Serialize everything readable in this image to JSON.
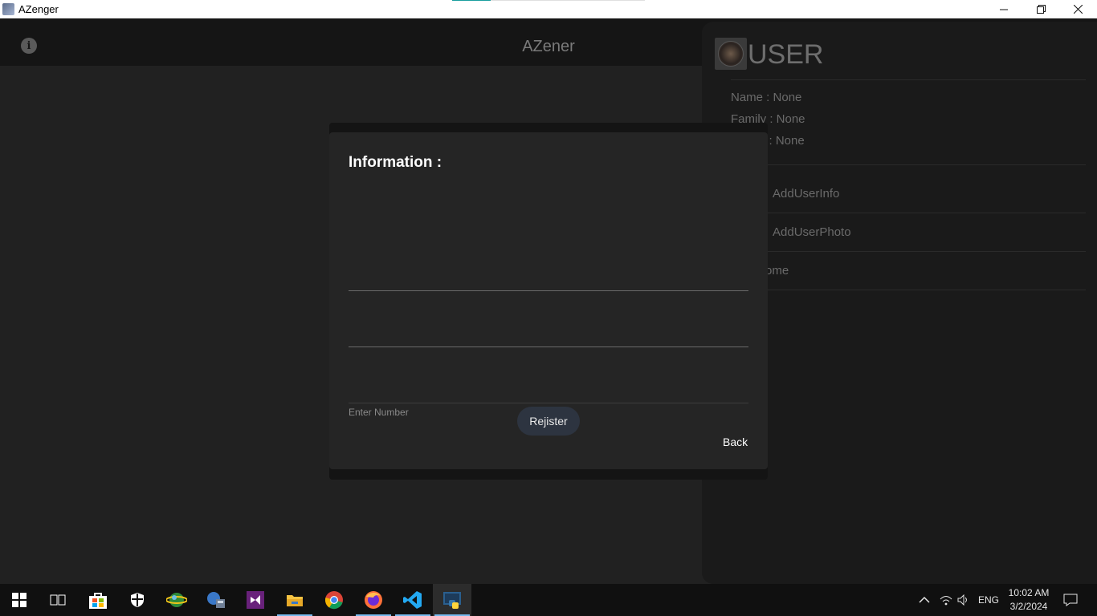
{
  "window": {
    "title": "AZenger",
    "progress": 0.2
  },
  "toolbar": {
    "title": "AZener",
    "info_icon": "info-icon"
  },
  "dialog": {
    "heading": "Information :",
    "fields": [
      {
        "value": "",
        "placeholder": ""
      },
      {
        "value": "",
        "placeholder": ""
      },
      {
        "value": "",
        "placeholder": ""
      }
    ],
    "helper": "Enter Number",
    "register_label": "Rejister",
    "back_label": "Back"
  },
  "drawer": {
    "title": "USER",
    "info": [
      {
        "label": "Name : None"
      },
      {
        "label": "Family : None"
      },
      {
        "label": "er : None"
      }
    ],
    "items": [
      {
        "label": "AddUserInfo"
      },
      {
        "label": "AddUserPhoto"
      },
      {
        "label": "ome"
      }
    ]
  },
  "taskbar": {
    "apps": [
      "start",
      "task-view",
      "store",
      "security",
      "globe-app",
      "network-app",
      "visual-studio",
      "file-explorer",
      "chrome",
      "firefox",
      "vscode",
      "python-app"
    ],
    "tray": {
      "language": "ENG",
      "time": "10:02 AM",
      "date": "3/2/2024"
    }
  },
  "colors": {
    "accent": "#1a9e9e",
    "dialog_bg": "#252525",
    "button_bg": "#2d3440"
  }
}
